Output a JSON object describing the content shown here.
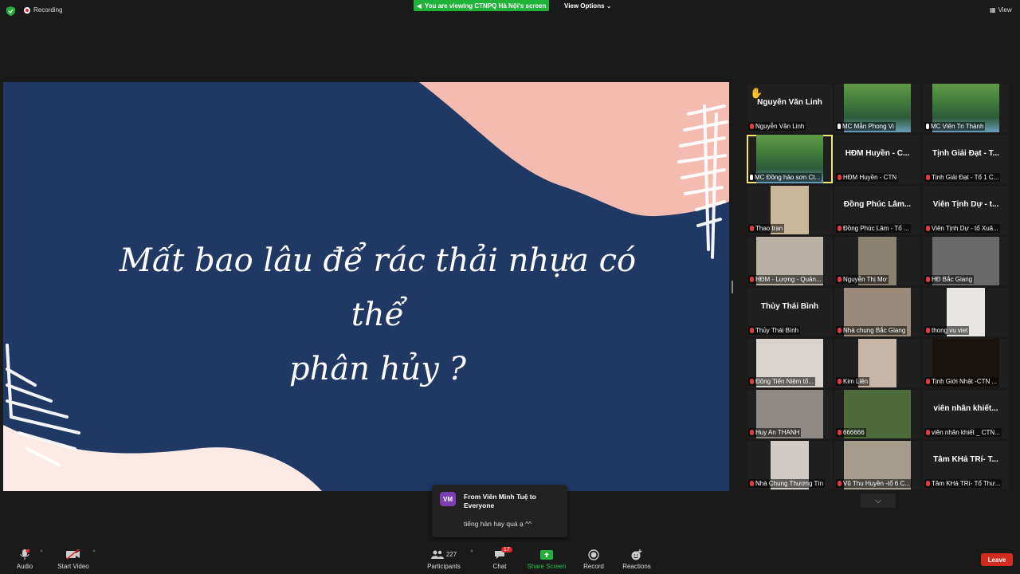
{
  "topbar": {
    "recording": "Recording",
    "viewing": "You are viewing CTNPQ Hà Nội's screen",
    "view_options": "View Options",
    "view": "View"
  },
  "slide": {
    "line1": "Mất bao lâu để rác thải nhựa có thể",
    "line2": "phân hủy ?",
    "colors": {
      "background": "#1f3864",
      "accent": "#f4bcb0",
      "light": "#fbeae6"
    }
  },
  "gallery": [
    {
      "name": "Nguyễn Văn Linh",
      "label": "Nguyễn Văn Linh",
      "video": false,
      "hand": true
    },
    {
      "name": "",
      "label": "MC Mẫn Phong Vi",
      "video": true,
      "pinned": true,
      "color": "#3f7a3a"
    },
    {
      "name": "",
      "label": "MC Viên Tri Thành",
      "video": true,
      "pinned": true,
      "color": "#3f7a3a"
    },
    {
      "name": "",
      "label": "MC Đồng hảo sơn Ct...",
      "video": true,
      "pinned": true,
      "color": "#3f7a3a",
      "active": true
    },
    {
      "name": "HĐM Huyền - C...",
      "label": "HĐM Huyền - CTN",
      "video": false
    },
    {
      "name": "Tịnh Giải Đạt - T...",
      "label": "Tịnh Giải Đạt - Tổ 1 C...",
      "video": false
    },
    {
      "name": "",
      "label": "Thao tran",
      "video": true,
      "color": "#c9b79a"
    },
    {
      "name": "Đồng Phúc Lâm...",
      "label": "Đồng Phúc Lâm - Tổ ...",
      "video": false
    },
    {
      "name": "Viên Tịnh Dự - t...",
      "label": "Viên Tịnh Dự - tổ Xuâ...",
      "video": false
    },
    {
      "name": "",
      "label": "HĐM - Lượng - Quản...",
      "video": true,
      "color": "#b8b0a4"
    },
    {
      "name": "",
      "label": "Nguyễn Thị Mơ",
      "video": true,
      "color": "#8a8172"
    },
    {
      "name": "",
      "label": "HĐ Bắc Giang",
      "video": true,
      "color": "#6b6a6a"
    },
    {
      "name": "Thủy Thái Bình",
      "label": "Thủy Thái Bình",
      "video": false
    },
    {
      "name": "",
      "label": "Nhà chung Bắc Giang",
      "video": true,
      "color": "#9a8a7a"
    },
    {
      "name": "",
      "label": "thong vu viet",
      "video": true,
      "color": "#e8e6e2"
    },
    {
      "name": "",
      "label": "Đông Tiến Niệm tổ...",
      "video": true,
      "color": "#d8d4cd"
    },
    {
      "name": "",
      "label": "Kim Liên",
      "video": true,
      "color": "#c5b6a9"
    },
    {
      "name": "",
      "label": "Tịnh Giới Nhật -CTN ...",
      "video": true,
      "color": "#1a120c"
    },
    {
      "name": "",
      "label": "Huy An THANH",
      "video": true,
      "color": "#8f8a86"
    },
    {
      "name": "",
      "label": "666666",
      "video": true,
      "color": "#4d6b3a"
    },
    {
      "name": "viên nhân khiết...",
      "label": "viên nhân khiết _ CTN...",
      "video": false
    },
    {
      "name": "",
      "label": "Nhà Chung Thương Tín",
      "video": true,
      "color": "#cfcac3"
    },
    {
      "name": "",
      "label": "Vũ Thu Huyền -tổ 6 C...",
      "video": true,
      "color": "#a59c8e"
    },
    {
      "name": "Tâm KHả TRí- T...",
      "label": "Tâm KHả TRí- Tổ Thư...",
      "video": false
    }
  ],
  "chat_popup": {
    "initials": "VM",
    "from": "From Viên Minh Tuệ to Everyone",
    "message": "tiếng hàn hay quá ạ ^^"
  },
  "toolbar": {
    "audio": "Audio",
    "start_video": "Start Video",
    "participants": "Participants",
    "participants_count": "227",
    "chat": "Chat",
    "chat_badge": "17",
    "share_screen": "Share Screen",
    "record": "Record",
    "reactions": "Reactions",
    "leave": "Leave"
  }
}
